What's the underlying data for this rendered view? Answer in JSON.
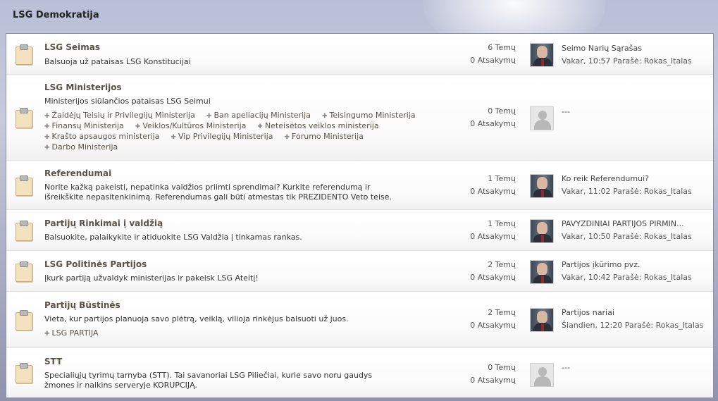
{
  "category": {
    "title": "LSG Demokratija"
  },
  "forums": [
    {
      "name": "LSG Seimas",
      "description": "Balsuoja už pataisas LSG Konstitucijai",
      "subforums": [],
      "topics": "6 Temų",
      "replies": "0 Atsakymų",
      "avatar": "user-photo",
      "last_title": "Seimo Narių Sąrašas",
      "last_time": "Vakar, 10:57",
      "last_by_label": "Parašė:",
      "last_author": "Rokas_Italas"
    },
    {
      "name": "LSG Ministerijos",
      "description": "Ministerijos siūlančios pataisas LSG Seimui",
      "subforums": [
        [
          "Žaidėjų Teisių ir Privilegijų Ministerija",
          "Ban apeliacijų Ministerija",
          "Teisingumo Ministerija"
        ],
        [
          "Finansų Ministerija",
          "Veiklos/Kultūros Ministerija",
          "Neteisėtos veiklos ministerija"
        ],
        [
          "Krašto apsaugos ministerija",
          "Vip Privilegijų Ministerija",
          "Forumo Ministerija"
        ],
        [
          "Darbo Ministerija"
        ]
      ],
      "topics": "0 Temų",
      "replies": "0 Atsakymų",
      "avatar": "blank",
      "last_title": "---"
    },
    {
      "name": "Referendumai",
      "description": "Norite kažką pakeisti, nepatinka valdžios priimti sprendimai? Kurkite referendumą ir išreikškite nepasitenkinimą. Referendumas gali būti atmestas tik PREZIDENTO Veto teise.",
      "subforums": [],
      "topics": "1 Temų",
      "replies": "0 Atsakymų",
      "avatar": "user-photo",
      "last_title": "Ko reik Referendumui?",
      "last_time": "Vakar, 11:02",
      "last_by_label": "Parašė:",
      "last_author": "Rokas_Italas"
    },
    {
      "name": "Partijų Rinkimai į valdžią",
      "description": "Balsuokite, palaikykite ir atiduokite LSG Valdžia į tinkamas rankas.",
      "subforums": [],
      "topics": "1 Temų",
      "replies": "0 Atsakymų",
      "avatar": "user-photo",
      "last_title": "PAVYZDINIAI PARTIJOS PIRMIN...",
      "last_time": "Vakar, 10:50",
      "last_by_label": "Parašė:",
      "last_author": "Rokas_Italas"
    },
    {
      "name": "LSG Politinės Partijos",
      "description": "Įkurk partiją užvaldyk ministerijas ir pakeisk LSG Ateitį!",
      "subforums": [],
      "topics": "2 Temų",
      "replies": "0 Atsakymų",
      "avatar": "user-photo",
      "last_title": "Partijos įkūrimo pvz.",
      "last_time": "Vakar, 10:42",
      "last_by_label": "Parašė:",
      "last_author": "Rokas_Italas"
    },
    {
      "name": "Partijų Būstinės",
      "description": "Vieta, kur partijos planuoja savo plėtrą, veiklą, vilioja rinkėjus balsuoti už juos.",
      "subforums": [
        [
          "LSG PARTIJA"
        ]
      ],
      "topics": "2 Temų",
      "replies": "0 Atsakymų",
      "avatar": "user-photo",
      "last_title": "Partijos nariai",
      "last_time": "Šiandien, 12:20",
      "last_by_label": "Parašė:",
      "last_author": "Rokas_Italas"
    },
    {
      "name": "STT",
      "description": "Specialiųjų tyrimų tarnyba (STT). Tai savanoriai LSG Piliečiai, kurie savo noru gaudys žmones ir naikins serveryje KORUPCIJĄ.",
      "subforums": [],
      "topics": "0 Temų",
      "replies": "0 Atsakymų",
      "avatar": "blank",
      "last_title": "---"
    }
  ]
}
